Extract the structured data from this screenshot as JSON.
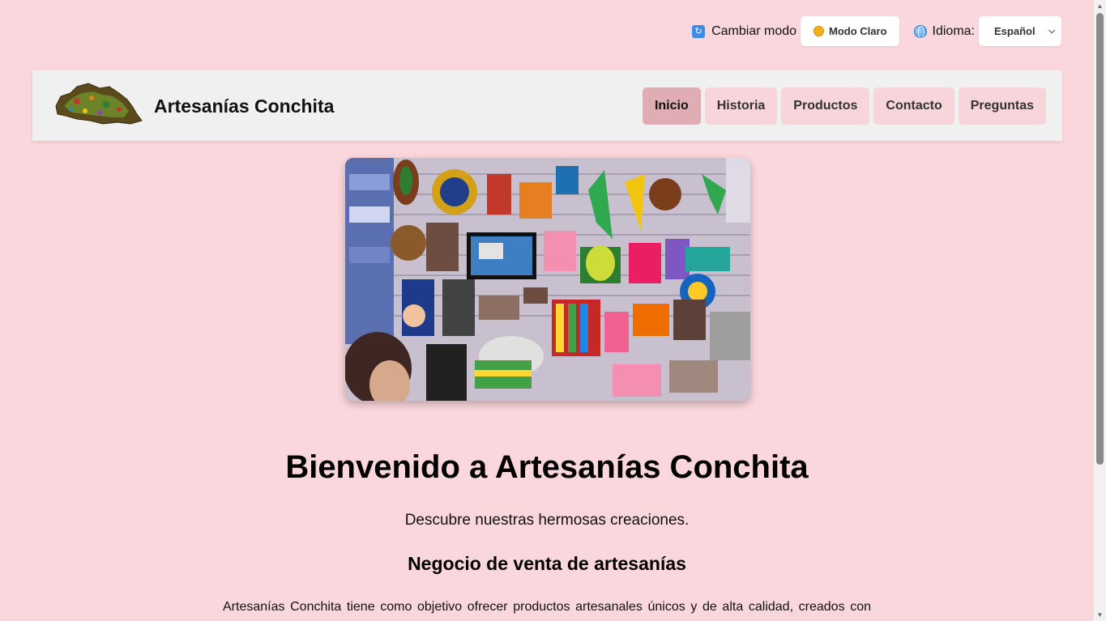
{
  "topbar": {
    "mode_label": "Cambiar modo",
    "mode_button": "Modo Claro",
    "language_label": "Idioma:",
    "language_selected": "Español"
  },
  "header": {
    "brand": "Artesanías Conchita",
    "nav": [
      {
        "label": "Inicio",
        "active": true
      },
      {
        "label": "Historia",
        "active": false
      },
      {
        "label": "Productos",
        "active": false
      },
      {
        "label": "Contacto",
        "active": false
      },
      {
        "label": "Preguntas",
        "active": false
      }
    ]
  },
  "main": {
    "title": "Bienvenido a Artesanías Conchita",
    "subtitle": "Descubre nuestras hermosas creaciones.",
    "section_title": "Negocio de venta de artesanías",
    "paragraph": "Artesanías Conchita tiene como objetivo ofrecer productos artesanales únicos y de alta calidad, creados con"
  },
  "colors": {
    "background": "#fad7dc",
    "header_bg": "#f0f0f0",
    "nav_bg": "#f8d5da",
    "nav_active_bg": "#e0adb4"
  },
  "icons": {
    "mode": "refresh-icon",
    "mode_button": "sun-icon",
    "language": "globe-icon",
    "select": "chevron-down-icon"
  }
}
